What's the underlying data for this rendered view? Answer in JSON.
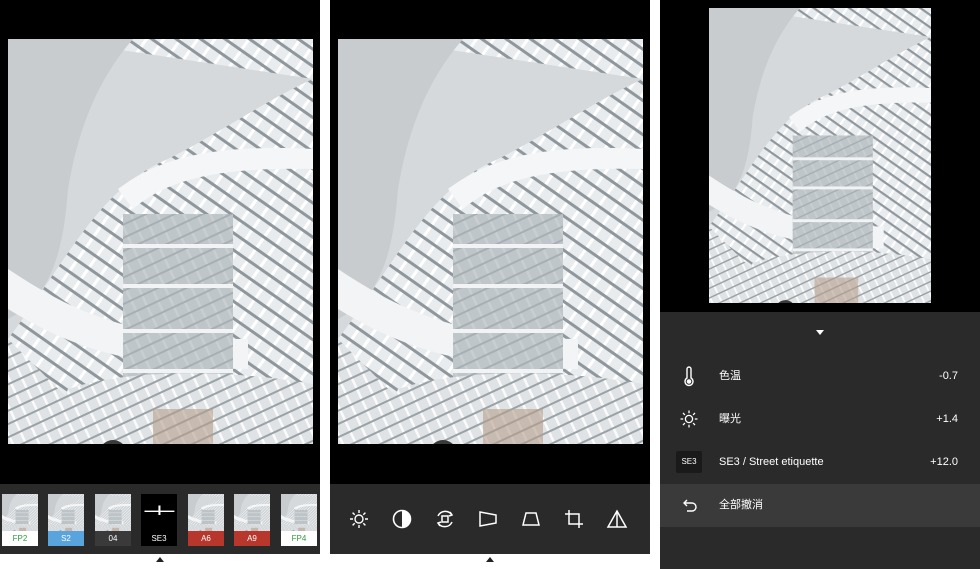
{
  "filters": [
    {
      "label": "FP2",
      "label_bg": "#ffffff",
      "label_color": "#2e9a3c"
    },
    {
      "label": "S2",
      "label_bg": "#5aa4de",
      "label_color": "#ffffff"
    },
    {
      "label": "04",
      "label_bg": "#3a3a3a",
      "label_color": "#ffffff"
    },
    {
      "label": "SE3",
      "label_bg": "#000000",
      "label_color": "#ffffff",
      "selected": true,
      "symbol": "—I—"
    },
    {
      "label": "A6",
      "label_bg": "#b8372d",
      "label_color": "#ffffff"
    },
    {
      "label": "A9",
      "label_bg": "#b8372d",
      "label_color": "#ffffff"
    },
    {
      "label": "FP4",
      "label_bg": "#ffffff",
      "label_color": "#2e9a3c"
    }
  ],
  "tools": [
    "exposure-tool",
    "contrast-tool",
    "rotate-tool",
    "perspective-tool",
    "keystone-tool",
    "crop-tool",
    "sharpen-tool"
  ],
  "adjustments": {
    "rows": [
      {
        "icon": "thermometer-icon",
        "label": "色温",
        "value": "-0.7"
      },
      {
        "icon": "sun-icon",
        "label": "曝光",
        "value": "+1.4"
      },
      {
        "icon": "filter-badge",
        "badge": "SE3",
        "label": "SE3 / Street etiquette",
        "value": "+12.0"
      }
    ],
    "reset_label": "全部撤消"
  },
  "colors": {
    "panel_bg": "#2a2a2a",
    "accent_green": "#2e9a3c",
    "accent_blue": "#5aa4de",
    "accent_red": "#b8372d"
  }
}
